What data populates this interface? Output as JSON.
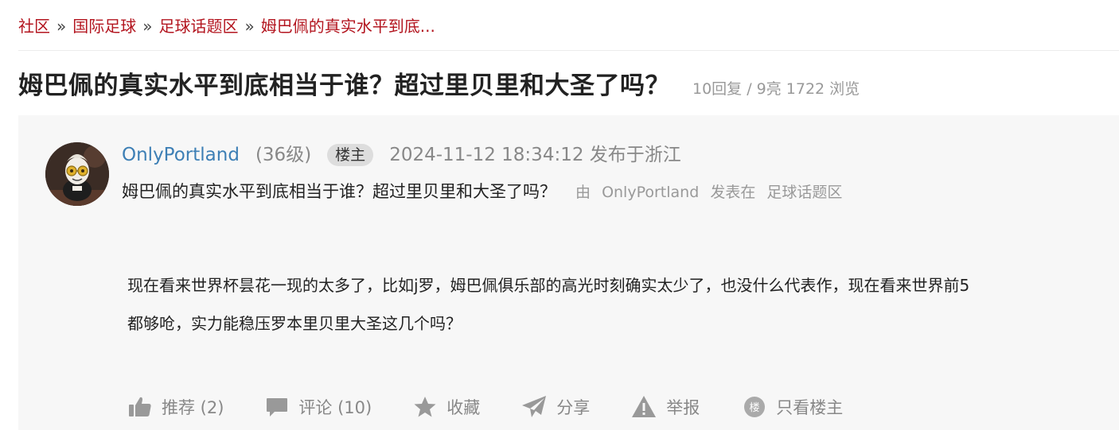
{
  "breadcrumb": {
    "items": [
      {
        "label": "社区"
      },
      {
        "label": "国际足球"
      },
      {
        "label": "足球话题区"
      },
      {
        "label": "姆巴佩的真实水平到底..."
      }
    ],
    "separator": "»"
  },
  "thread": {
    "title": "姆巴佩的真实水平到底相当于谁？超过里贝里和大圣了吗？",
    "stats": "10回复 / 9亮 1722 浏览"
  },
  "post": {
    "author": "OnlyPortland",
    "level": "(36级)",
    "badge": "楼主",
    "timestamp": "2024-11-12 18:34:12 发布于浙江",
    "sub_title": "姆巴佩的真实水平到底相当于谁？超过里贝里和大圣了吗？",
    "sub_by": "由",
    "sub_author": "OnlyPortland",
    "sub_posted_in": "发表在",
    "sub_forum": "足球话题区",
    "body_line1": "现在看来世界杯昙花一现的太多了，比如j罗，姆巴佩俱乐部的高光时刻确实太少了，也没什么代表作，现在看来世界前5",
    "body_line2": "都够呛，实力能稳压罗本里贝里大圣这几个吗？"
  },
  "actions": {
    "recommend": "推荐 (2)",
    "comment": "评论 (10)",
    "collect": "收藏",
    "share": "分享",
    "report": "举报",
    "only_op": "只看楼主",
    "only_op_icon_char": "楼"
  },
  "colors": {
    "breadcrumb_link": "#b3151f",
    "username": "#3d7fb5",
    "muted": "#888888",
    "post_bg": "#f7f7f7"
  },
  "icons": [
    "thumbs-up-icon",
    "comment-icon",
    "star-icon",
    "share-icon",
    "warning-icon",
    "only-op-icon"
  ]
}
